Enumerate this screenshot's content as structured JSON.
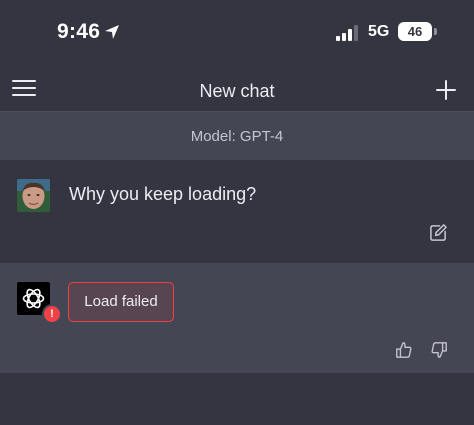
{
  "status_bar": {
    "time": "9:46",
    "network": "5G",
    "battery": "46"
  },
  "nav": {
    "title": "New chat"
  },
  "model_bar": {
    "label": "Model: GPT-4"
  },
  "messages": [
    {
      "role": "user",
      "text": "Why you keep loading?"
    },
    {
      "role": "assistant",
      "text": "Load failed",
      "error": true
    }
  ],
  "icons": {
    "status": [
      "location-arrow-icon",
      "cellular-signal-icon",
      "battery-icon"
    ],
    "nav": [
      "hamburger-menu-icon",
      "plus-icon"
    ],
    "message_actions": [
      "edit-icon",
      "thumbs-up-icon",
      "thumbs-down-icon"
    ],
    "assistant": [
      "openai-logo-icon",
      "error-badge-icon"
    ]
  },
  "colors": {
    "background": "#343541",
    "secondary_background": "#444654",
    "error": "#ef4146",
    "text": "#ececf1"
  }
}
